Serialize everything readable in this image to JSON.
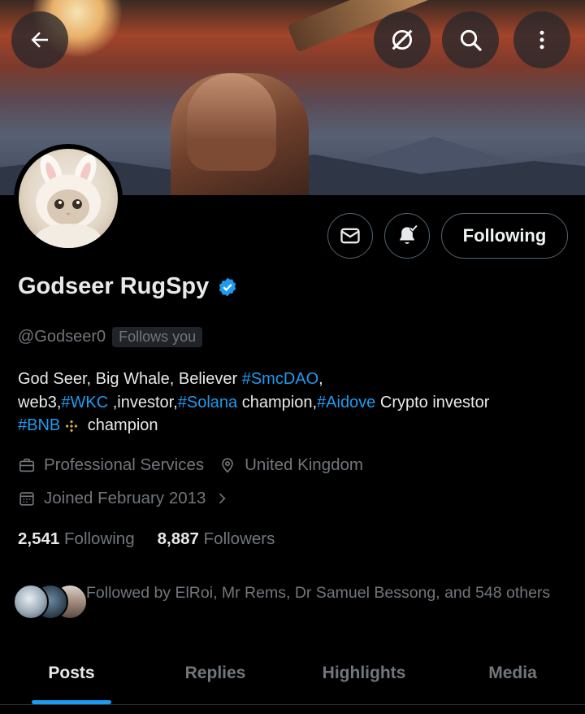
{
  "header": {
    "back_icon": "arrow-left-icon",
    "grok_icon": "grok-icon",
    "search_icon": "search-icon",
    "more_icon": "more-vertical-icon"
  },
  "actions": {
    "message_icon": "envelope-icon",
    "notify_icon": "bell-plus-icon",
    "follow_label": "Following"
  },
  "profile": {
    "name": "Godseer RugSpy",
    "verified": true,
    "handle": "@Godseer0",
    "follows_you": "Follows you",
    "bio": {
      "line1_text": "God Seer, Big Whale, Believer ",
      "line1_tag": "#SmcDAO",
      "line1_end": ",",
      "line2_a": "web3,",
      "line2_tag1": "#WKC",
      "line2_b": " ,investor,",
      "line2_tag2": "#Solana",
      "line2_c": " champion,",
      "line2_tag3": "#Aidove",
      "line2_d": " Crypto investor",
      "line3_tag": "#BNB",
      "line3_end": " champion"
    },
    "category": "Professional Services",
    "location": "United Kingdom",
    "joined": "Joined February 2013",
    "following_count": "2,541",
    "following_label": "Following",
    "followers_count": "8,887",
    "followers_label": "Followers",
    "followed_by": "Followed by ElRoi, Mr Rems, Dr Samuel Bessong, and 548 others"
  },
  "tabs": [
    {
      "label": "Posts",
      "active": true
    },
    {
      "label": "Replies",
      "active": false
    },
    {
      "label": "Highlights",
      "active": false
    },
    {
      "label": "Media",
      "active": false
    }
  ],
  "colors": {
    "accent": "#1d9bf0",
    "muted": "#71767b",
    "text": "#e7e9ea",
    "background": "#000000"
  }
}
